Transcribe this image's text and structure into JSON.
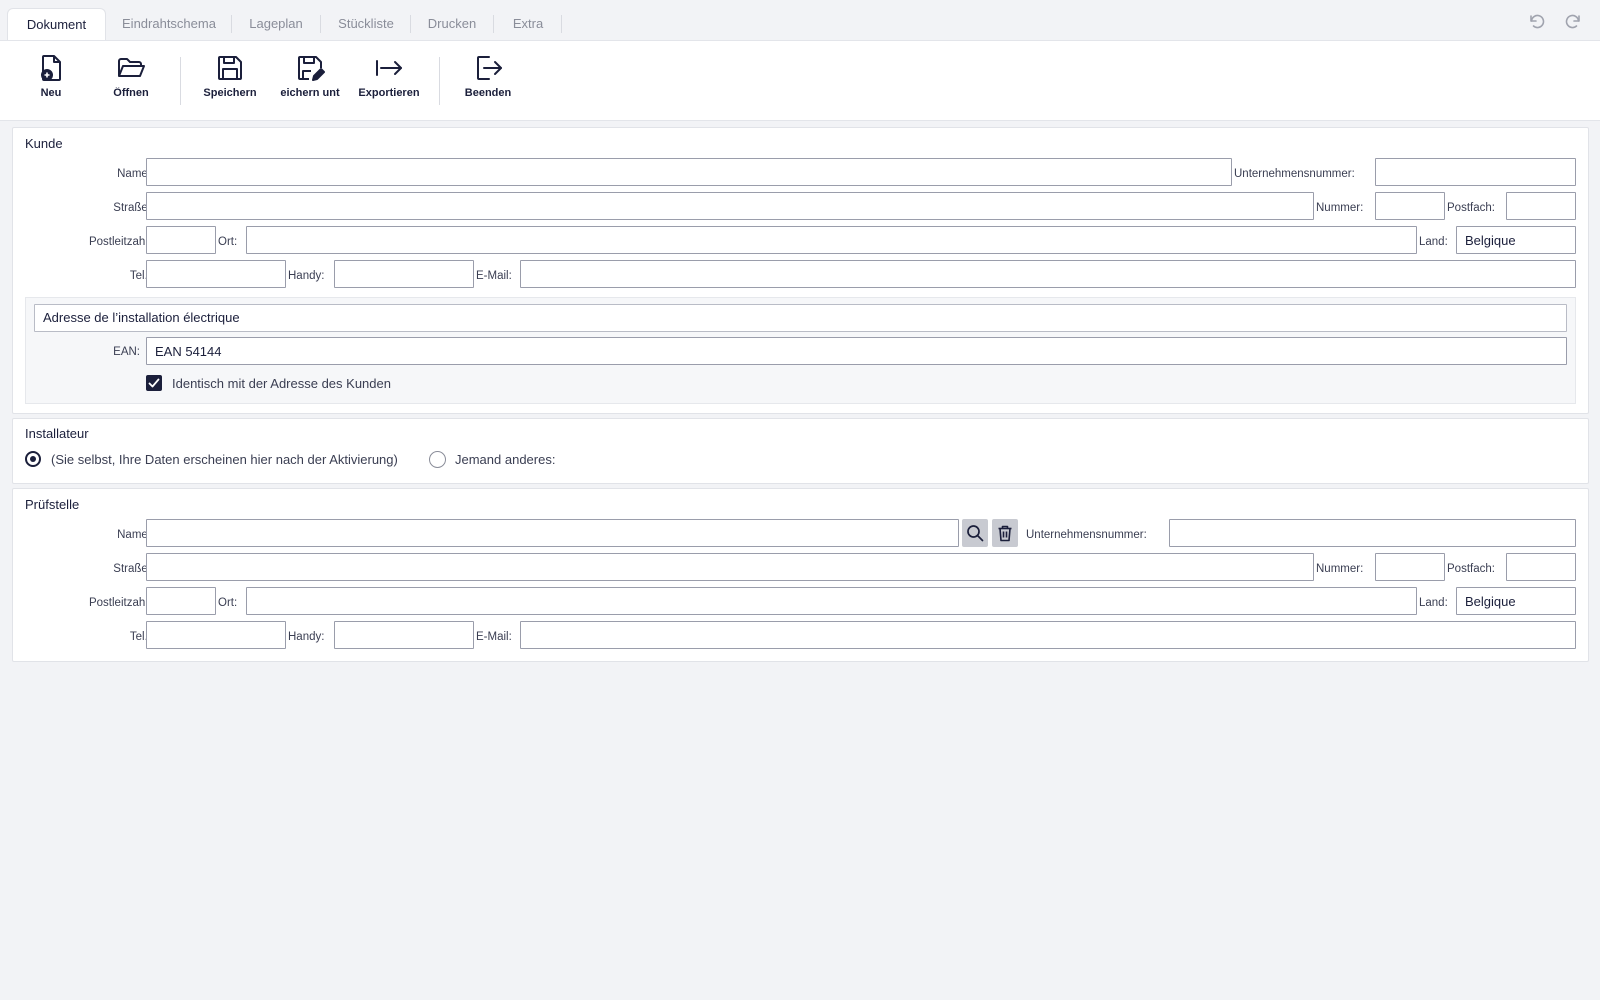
{
  "tabs": [
    "Dokument",
    "Eindrahtschema",
    "Lageplan",
    "Stückliste",
    "Drucken",
    "Extra"
  ],
  "toolbar": {
    "new": "Neu",
    "open": "Öffnen",
    "save": "Speichern",
    "save_as": "eichern unt",
    "export": "Exportieren",
    "quit": "Beenden"
  },
  "customer": {
    "title": "Kunde",
    "labels": {
      "name": "Name:",
      "company_number": "Unternehmensnummer:",
      "street": "Straße:",
      "number": "Nummer:",
      "po_box": "Postfach:",
      "postal_code": "Postleitzahl:",
      "city": "Ort:",
      "country": "Land:",
      "tel": "Tel.:",
      "mobile": "Handy:",
      "email": "E-Mail:"
    },
    "values": {
      "name": "",
      "company_number": "",
      "street": "",
      "number": "",
      "po_box": "",
      "postal_code": "",
      "city": "",
      "country": "Belgique",
      "tel": "",
      "mobile": "",
      "email": ""
    },
    "installation": {
      "title": "Adresse de l’installation électrique",
      "ean_label": "EAN:",
      "ean_value": "EAN 54144",
      "same_address_label": "Identisch mit der Adresse des Kunden",
      "same_address_checked": true
    }
  },
  "installer": {
    "title": "Installateur",
    "option_self": "(Sie selbst, Ihre Daten erscheinen hier nach der Aktivierung)",
    "option_other": "Jemand anderes:",
    "selected": "self"
  },
  "inspection": {
    "title": "Prüfstelle",
    "labels": {
      "name": "Name:",
      "company_number": "Unternehmensnummer:",
      "street": "Straße:",
      "number": "Nummer:",
      "po_box": "Postfach:",
      "postal_code": "Postleitzahl:",
      "city": "Ort:",
      "country": "Land:",
      "tel": "Tel.:",
      "mobile": "Handy:",
      "email": "E-Mail:"
    },
    "values": {
      "name": "",
      "company_number": "",
      "street": "",
      "number": "",
      "po_box": "",
      "postal_code": "",
      "city": "",
      "country": "Belgique",
      "tel": "",
      "mobile": "",
      "email": ""
    }
  },
  "icons": {
    "new": "file-plus-icon",
    "open": "folder-open-icon",
    "save": "floppy-disk-icon",
    "save_as": "floppy-edit-icon",
    "export": "arrow-right-bar-icon",
    "quit": "logout-icon",
    "undo": "undo-icon",
    "redo": "redo-icon",
    "search": "search-icon",
    "delete": "trash-icon"
  },
  "colors": {
    "accent": "#1b1f3b",
    "background": "#f2f3f6",
    "panel": "#ffffff"
  }
}
